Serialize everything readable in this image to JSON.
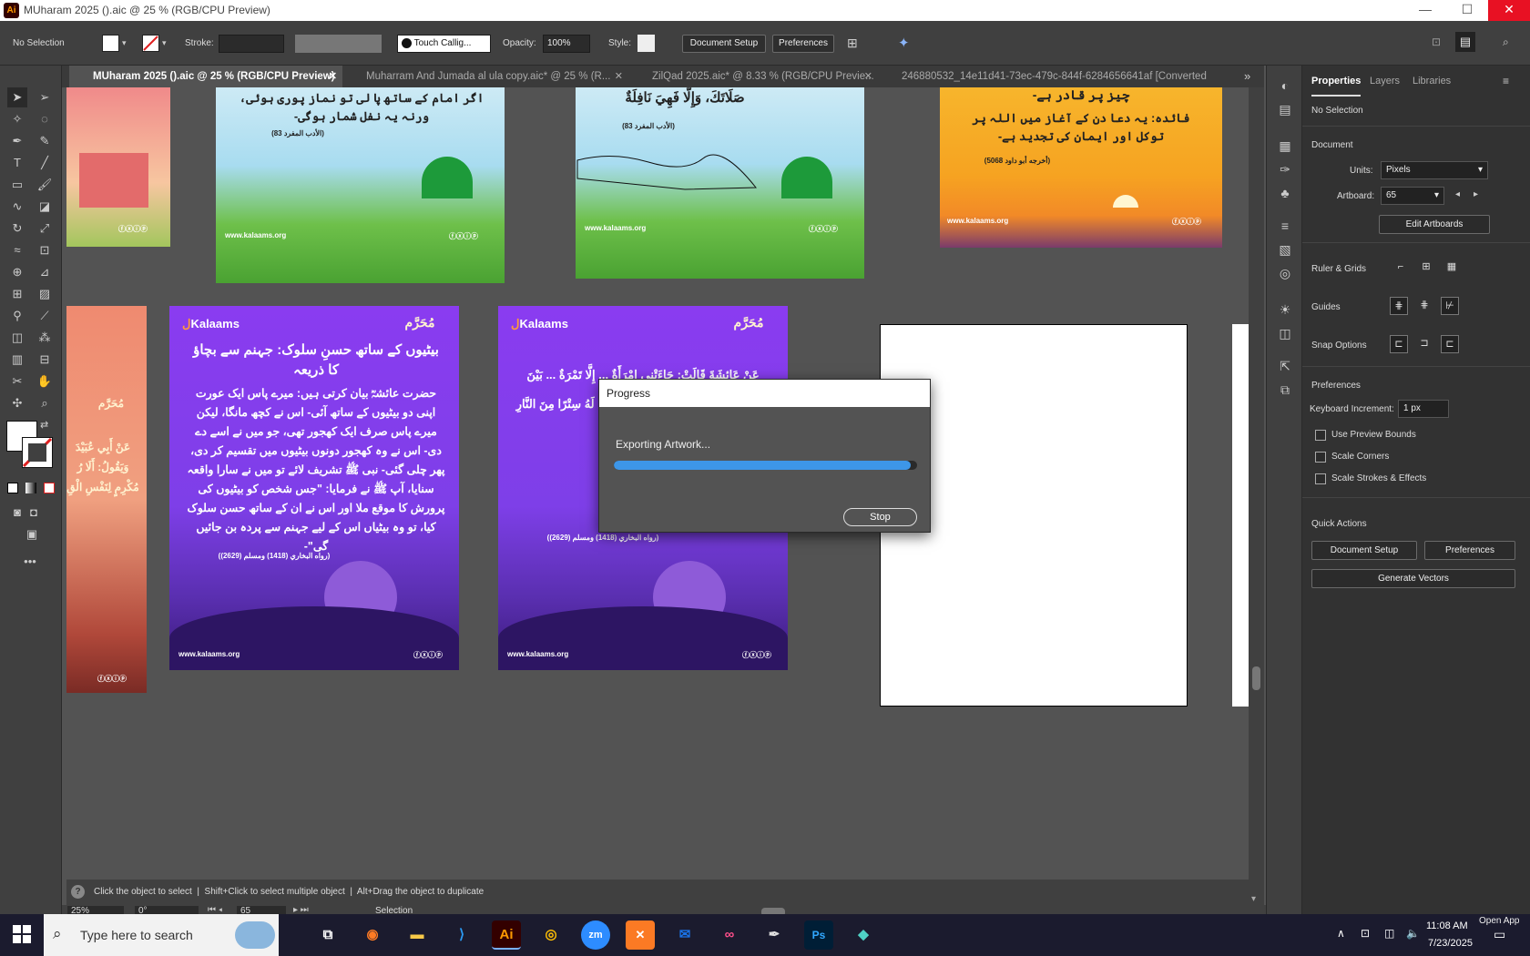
{
  "titlebar": {
    "title": "MUharam 2025 ().aic @ 25 % (RGB/CPU Preview)",
    "logo": "Ai",
    "minimize": "—",
    "maximize": "☐",
    "close": "✕"
  },
  "control": {
    "selection": "No Selection",
    "stroke_label": "Stroke:",
    "brush": "Touch Callig...",
    "opacity_label": "Opacity:",
    "opacity_value": "100%",
    "style_label": "Style:",
    "document_setup": "Document Setup",
    "preferences": "Preferences"
  },
  "tabs": [
    {
      "label": "MUharam 2025 ().aic @ 25 % (RGB/CPU Preview)",
      "active": true
    },
    {
      "label": "Muharram And Jumada al ula copy.aic* @ 25 % (R...",
      "active": false
    },
    {
      "label": "ZilQad 2025.aic* @ 8.33 % (RGB/CPU Previe...",
      "active": false
    },
    {
      "label": "246880532_14e11d41-73ec-479c-844f-6284656641af [Converted",
      "active": false
    }
  ],
  "tab_overflow": "»",
  "artboards": {
    "a2_text": "اگر امام کے ساتھ پا لی تو نماز پوری ہوئی، ورنہ یہ نفل شمار ہوگی-",
    "a2_ref": "(الأدب المفرد 83)",
    "a3_text": "صَلَاتَكَ، وَإِلَّا فَهِيَ نَافِلَةٌ",
    "a3_ref": "(الأدب المفرد 83)",
    "a4_text1": "چیز پر قادر ہے-",
    "a4_text2": "فائدہ: یہ دعا دن کے آغاز میں اللہ پر توکل اور ایمان کی تجدید ہے-",
    "a4_ref": "(أخرجه أبو داود 5068)",
    "website": "www.kalaams.org",
    "brand": "Kalaams",
    "muharram": "مُحَرَّم",
    "p1_title": "بیٹیوں کے ساتھ حسنِ سلوک: جہنم سے بچاؤ کا ذریعہ",
    "p1_body": "حضرت عائشہؓ بیان کرتی ہیں: میرے پاس ایک عورت اپنی دو بیٹیوں کے ساتھ آئی- اس نے کچھ مانگا، لیکن میرے پاس صرف ایک کھجور تھی، جو میں نے اسے دے دی- اس نے وہ کھجور دونوں بیٹیوں میں تقسیم کر دی، پھر چلی گئی- نبی ﷺ تشریف لائے تو میں نے سارا واقعہ سنایا، آپ ﷺ نے فرمایا: \"جس شخص کو بیٹیوں کی پرورش کا موقع ملا اور اس نے ان کے ساتھ حسن سلوک کیا، تو وہ بیٹیاں اس کے لیے جہنم سے پردہ بن جائیں گی\"-",
    "p1_ref": "(رواه البخاري (1418) ومسلم (2629))",
    "p2_text": "عَنْ عَائِشَةَ قَالَتْ: جَاءَتْنِي امْرَأَةٌ ... إِلَّا تَمْرَةٌ ... بَيْنَ ابْنَتَيْهَا ... حَدَّثْتُهُ ... فَأَحْسَنَ إِلَيْهِنَّ، كُنَّ لَهُ سِتْرًا مِنَ النَّارِ",
    "p2_ref": "(رواه البخاري (1418) ومسلم (2629))",
    "left_text": "عَنْ أَبِي عُبَيْدَ وَيَقُولُ: أَلَا رُ مُكْرِمٍ لِنَفْسِ الْقِ"
  },
  "dialog": {
    "title": "Progress",
    "message": "Exporting Artwork...",
    "progress": 0.98,
    "stop": "Stop"
  },
  "hint": {
    "text": "Click the object to select  |  Shift+Click to select multiple object  |  Alt+Drag the object to duplicate",
    "icon": "?"
  },
  "status": {
    "zoom": "25%",
    "rotation": "0°",
    "artboard": "65",
    "tool": "Selection"
  },
  "properties": {
    "tabs": [
      "Properties",
      "Layers",
      "Libraries"
    ],
    "no_selection": "No Selection",
    "document": "Document",
    "units_label": "Units:",
    "units_value": "Pixels",
    "artboard_label": "Artboard:",
    "artboard_value": "65",
    "edit_artboards": "Edit Artboards",
    "ruler_grids": "Ruler & Grids",
    "guides": "Guides",
    "snap_options": "Snap Options",
    "preferences": "Preferences",
    "kb_label": "Keyboard Increment:",
    "kb_value": "1 px",
    "use_preview": "Use Preview Bounds",
    "scale_corners": "Scale Corners",
    "scale_strokes": "Scale Strokes & Effects",
    "quick_actions": "Quick Actions",
    "doc_setup": "Document Setup",
    "prefs_btn": "Preferences",
    "gen_vectors": "Generate Vectors"
  },
  "taskbar": {
    "search_placeholder": "Type here to search",
    "time": "11:08 AM",
    "date": "7/23/2025",
    "open_app": "Open App",
    "apps": [
      "Task View",
      "Firefox",
      "File Explorer",
      "VS Code",
      "Illustrator",
      "Chrome",
      "Zoom",
      "XAMPP",
      "Outlook",
      "Creative Cloud",
      "Pen",
      "Photoshop",
      "App"
    ]
  }
}
